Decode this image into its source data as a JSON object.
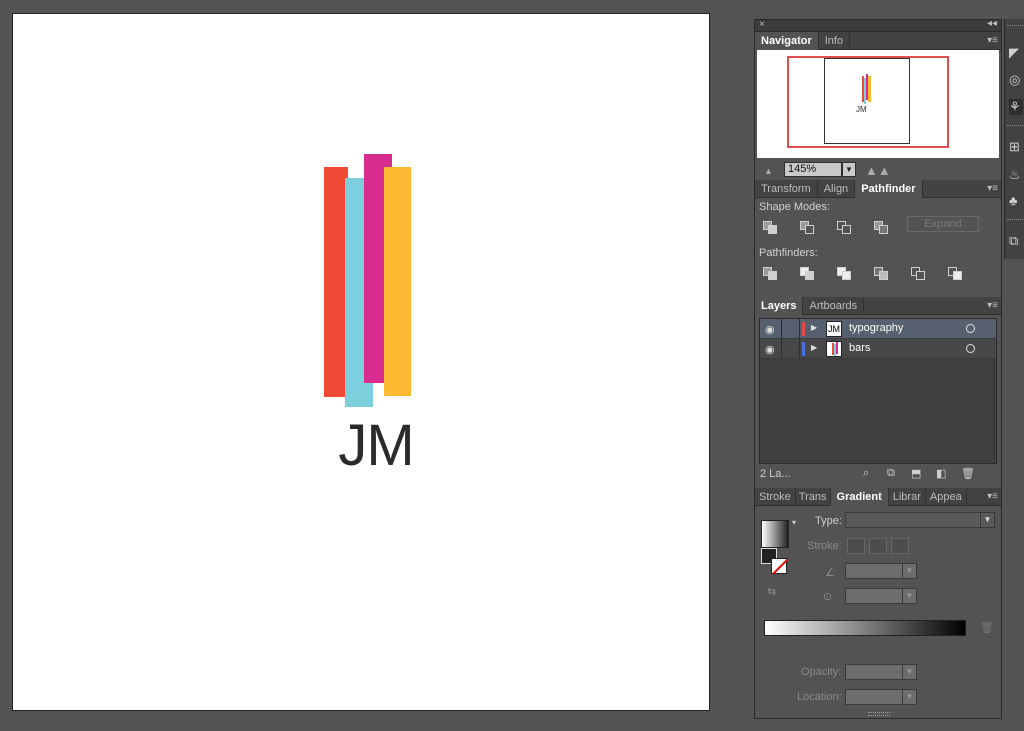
{
  "artboard": {
    "logo_text": "JM",
    "bar_colors": [
      "#ef4a36",
      "#7ccfdc",
      "#d82c8f",
      "#fdb931"
    ]
  },
  "dock": {
    "close_glyph": "×",
    "collapse_glyph": "◂◂"
  },
  "navigator": {
    "tabs": [
      "Navigator",
      "Info"
    ],
    "active_tab": "Navigator",
    "preview_text": "JM",
    "zoom": "145%",
    "zoom_out_icon": "mountain-small-icon",
    "zoom_in_icon": "mountain-large-icon",
    "view_box_color": "#e04d4d"
  },
  "pathfinder": {
    "tabs": [
      "Transform",
      "Align",
      "Pathfinder"
    ],
    "active_tab": "Pathfinder",
    "shape_modes_label": "Shape Modes:",
    "pathfinders_label": "Pathfinders:",
    "expand_label": "Expand"
  },
  "layers": {
    "tabs": [
      "Layers",
      "Artboards"
    ],
    "active_tab": "Layers",
    "items": [
      {
        "name": "typography",
        "thumb": "JM",
        "color": "#e04d4d",
        "selected": true
      },
      {
        "name": "bars",
        "thumb": "",
        "color": "#4a6fe0",
        "selected": false
      }
    ],
    "count_label": "2 La..."
  },
  "gradient": {
    "tabs": [
      "Stroke",
      "Trans",
      "Gradient",
      "Librar",
      "Appea"
    ],
    "active_tab": "Gradient",
    "type_label": "Type:",
    "stroke_label": "Stroke:",
    "opacity_label": "Opacity:",
    "location_label": "Location:",
    "gradient_start": "#ffffff",
    "gradient_end": "#000000"
  }
}
